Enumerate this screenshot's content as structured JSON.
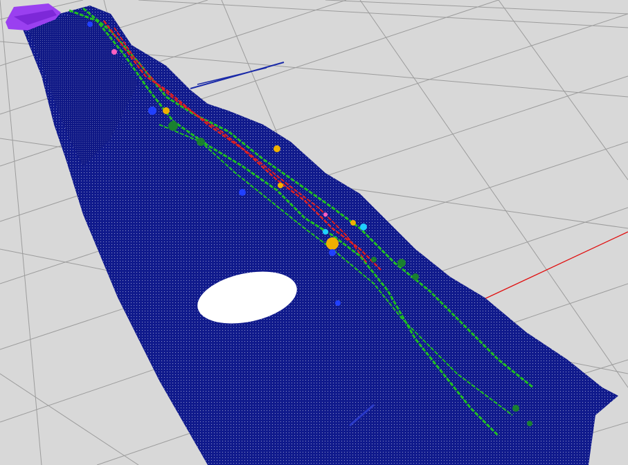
{
  "viewer": {
    "background_color": "#d8d8d8",
    "grid_color": "#a0a0a0",
    "axis_x_color": "#e01010",
    "cloud_base_color": "#101a8c",
    "cloud_dot_color": "#ffffff",
    "lane_line_color": "#20c020",
    "curb_color": "#e02020",
    "object_colors": [
      "#f0b000",
      "#20d0ff",
      "#ff60c0",
      "#2040ff",
      "#1a8030"
    ],
    "vehicle_color": "#9a40f0",
    "hole_color": "#ffffff"
  }
}
